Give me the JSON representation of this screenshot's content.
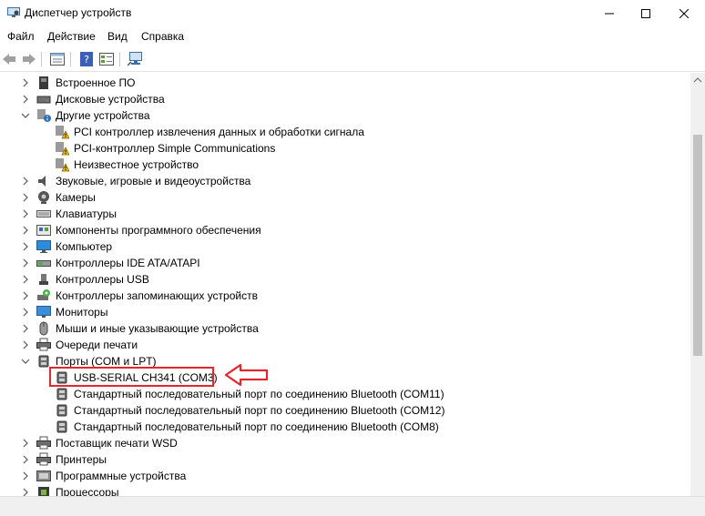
{
  "window": {
    "title": "Диспетчер устройств",
    "controls": [
      "minimize",
      "maximize",
      "close"
    ]
  },
  "menu": [
    "Файл",
    "Действие",
    "Вид",
    "Справка"
  ],
  "toolbar": [
    "back-icon",
    "forward-icon",
    "properties-icon",
    "help-icon",
    "view-icon",
    "scan-hardware-icon"
  ],
  "tree": [
    {
      "level": 0,
      "state": "collapsed",
      "icon": "firmware-icon",
      "label": "Встроенное ПО"
    },
    {
      "level": 0,
      "state": "collapsed",
      "icon": "disk-icon",
      "label": "Дисковые устройства"
    },
    {
      "level": 0,
      "state": "expanded",
      "icon": "other-devices-icon",
      "label": "Другие устройства"
    },
    {
      "level": 1,
      "state": "leaf",
      "icon": "warning-device-icon",
      "label": "PCI контроллер извлечения данных и обработки сигнала"
    },
    {
      "level": 1,
      "state": "leaf",
      "icon": "warning-device-icon",
      "label": "PCI-контроллер Simple Communications"
    },
    {
      "level": 1,
      "state": "leaf",
      "icon": "warning-device-icon",
      "label": "Неизвестное устройство"
    },
    {
      "level": 0,
      "state": "collapsed",
      "icon": "speaker-icon",
      "label": "Звуковые, игровые и видеоустройства"
    },
    {
      "level": 0,
      "state": "collapsed",
      "icon": "camera-icon",
      "label": "Камеры"
    },
    {
      "level": 0,
      "state": "collapsed",
      "icon": "keyboard-icon",
      "label": "Клавиатуры"
    },
    {
      "level": 0,
      "state": "collapsed",
      "icon": "software-component-icon",
      "label": "Компоненты программного обеспечения"
    },
    {
      "level": 0,
      "state": "collapsed",
      "icon": "computer-icon",
      "label": "Компьютер"
    },
    {
      "level": 0,
      "state": "collapsed",
      "icon": "ide-controller-icon",
      "label": "Контроллеры IDE ATA/ATAPI"
    },
    {
      "level": 0,
      "state": "collapsed",
      "icon": "usb-icon",
      "label": "Контроллеры USB"
    },
    {
      "level": 0,
      "state": "collapsed",
      "icon": "storage-controller-icon",
      "label": "Контроллеры запоминающих устройств"
    },
    {
      "level": 0,
      "state": "collapsed",
      "icon": "monitor-icon",
      "label": "Мониторы"
    },
    {
      "level": 0,
      "state": "collapsed",
      "icon": "mouse-icon",
      "label": "Мыши и иные указывающие устройства"
    },
    {
      "level": 0,
      "state": "collapsed",
      "icon": "print-queue-icon",
      "label": "Очереди печати"
    },
    {
      "level": 0,
      "state": "expanded",
      "icon": "port-icon",
      "label": "Порты (COM и LPT)"
    },
    {
      "level": 1,
      "state": "leaf",
      "icon": "port-icon",
      "label": "USB-SERIAL CH341 (COM3)",
      "highlighted": true
    },
    {
      "level": 1,
      "state": "leaf",
      "icon": "port-icon",
      "label": "Стандартный последовательный порт по соединению Bluetooth (COM11)"
    },
    {
      "level": 1,
      "state": "leaf",
      "icon": "port-icon",
      "label": "Стандартный последовательный порт по соединению Bluetooth (COM12)"
    },
    {
      "level": 1,
      "state": "leaf",
      "icon": "port-icon",
      "label": "Стандартный последовательный порт по соединению Bluetooth (COM8)"
    },
    {
      "level": 0,
      "state": "collapsed",
      "icon": "printer-icon",
      "label": "Поставщик печати WSD"
    },
    {
      "level": 0,
      "state": "collapsed",
      "icon": "printer-icon",
      "label": "Принтеры"
    },
    {
      "level": 0,
      "state": "collapsed",
      "icon": "software-device-icon",
      "label": "Программные устройства"
    },
    {
      "level": 0,
      "state": "collapsed",
      "icon": "processor-icon",
      "label": "Процессоры"
    }
  ],
  "colors": {
    "highlight": "#e0282e",
    "warning": "#f2c200",
    "accent": "#1e73c8"
  }
}
